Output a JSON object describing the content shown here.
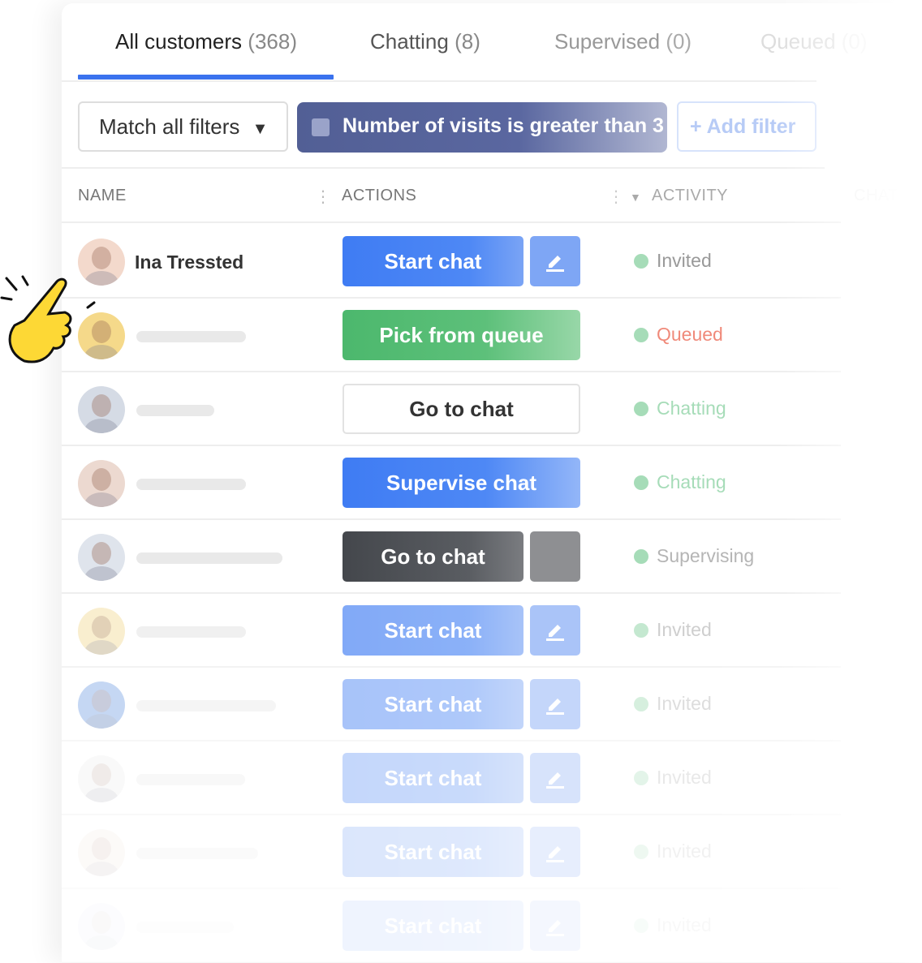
{
  "tabs": [
    {
      "label": "All customers",
      "count": "(368)",
      "active": true
    },
    {
      "label": "Chatting",
      "count": "(8)"
    },
    {
      "label": "Supervised",
      "count": "(0)"
    },
    {
      "label": "Queued",
      "count": "(0)"
    }
  ],
  "filters": {
    "match_label": "Match all filters",
    "match_caret": "▼",
    "active_filter": "Number of visits is greater than 3",
    "add_filter": "+ Add filter"
  },
  "columns": {
    "name": "NAME",
    "actions": "ACTIONS",
    "activity": "ACTIVITY",
    "chat": "CHAT"
  },
  "colors": {
    "accent": "#3a72ee",
    "green": "#4cb86d",
    "dark": "#4a4c50",
    "status_dot": "#a6dcb8",
    "queued": "#f08a7a"
  },
  "rows": [
    {
      "name": "Ina Tressted",
      "action": "Start chat",
      "style": "blue",
      "edit": true,
      "status": "Invited",
      "status_color": "#999"
    },
    {
      "name": "",
      "action": "Pick from queue",
      "style": "green",
      "edit": false,
      "status": "Queued",
      "status_color": "#f08a7a"
    },
    {
      "name": "",
      "action": "Go to chat",
      "style": "outline",
      "edit": false,
      "status": "Chatting",
      "status_color": "#a6dcb8"
    },
    {
      "name": "",
      "action": "Supervise chat",
      "style": "blue-wide",
      "edit": false,
      "status": "Chatting",
      "status_color": "#a6dcb8"
    },
    {
      "name": "",
      "action": "Go to chat",
      "style": "dark",
      "edit": true,
      "status": "Supervising",
      "status_color": "#b5b5b5"
    },
    {
      "name": "",
      "action": "Start chat",
      "style": "blue",
      "edit": true,
      "status": "Invited",
      "status_color": "#b5b5b5"
    },
    {
      "name": "",
      "action": "Start chat",
      "style": "blue",
      "edit": true,
      "status": "Invited",
      "status_color": "#b5b5b5"
    },
    {
      "name": "",
      "action": "Start chat",
      "style": "blue",
      "edit": true,
      "status": "Invited",
      "status_color": "#b5b5b5"
    },
    {
      "name": "",
      "action": "Start chat",
      "style": "blue",
      "edit": true,
      "status": "Invited",
      "status_color": "#b5b5b5"
    },
    {
      "name": "",
      "action": "Start chat",
      "style": "blue",
      "edit": true,
      "status": "Invited",
      "status_color": "#b5b5b5"
    }
  ]
}
